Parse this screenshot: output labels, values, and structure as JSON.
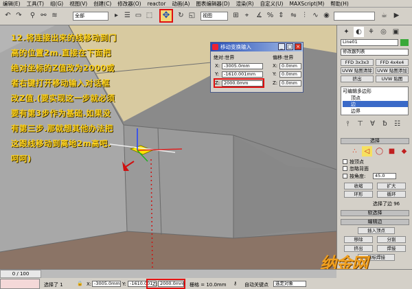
{
  "menu": [
    "编辑(E)",
    "工具(T)",
    "组(G)",
    "视图(V)",
    "创建(C)",
    "修改器(O)",
    "reactor",
    "动画(A)",
    "图表编辑器(D)",
    "渲染(R)",
    "自定义(U)",
    "MAXScript(M)",
    "帮助(H)"
  ],
  "toolbar": {
    "selection_filter": "全部",
    "coord_system": "视图"
  },
  "instruction": "12.将连接出来的线移动到门高的位置2m.直接在下面把绝对坐标的Z值改为2000或者右键打开移动输入对话框改Z值.(要实现这一步就必须要有第3步作为基础.如果没有第三步.那就想其他办法把这跟线移动到离地2m高吧.呵呵)",
  "dialog": {
    "title": "移动变换输入",
    "absolute_label": "绝对:世界",
    "offset_label": "偏移:世界",
    "absolute": {
      "x": "-3005.0mm",
      "y": "-1610.001mm",
      "z": "2000.0mm"
    },
    "offset": {
      "x": "0.0mm",
      "y": "0.0mm",
      "z": "0.0mm"
    },
    "axes": [
      "X:",
      "Y:",
      "Z:"
    ]
  },
  "panel": {
    "object_name": "Line01",
    "modifier_list": "修改器列表",
    "buttons": [
      "FFD 3x3x3",
      "FFD 4x4x4",
      "UVW 贴图清除",
      "UVW 贴图添加",
      "挤出",
      "UVW 贴图"
    ],
    "stack": [
      "可编辑多边形",
      "顶点",
      "边",
      "边界"
    ],
    "selection_rollout": "选择",
    "by_vertex": "按顶点",
    "ignore_backfacing": "忽略背面",
    "by_angle": "按角度:",
    "angle_value": "45.0",
    "shrink": "收缩",
    "grow": "扩大",
    "ring": "环形",
    "loop": "循环",
    "selected_info": "选择了边 96",
    "soft_selection": "软选择",
    "edit_edges": "编辑边",
    "insert_vertex": "插入顶点",
    "remove": "移除",
    "split": "分割",
    "extrude": "挤出",
    "weld": "焊接",
    "target_weld": "目标焊接"
  },
  "status": {
    "time": "0 / 100",
    "selected": "选择了 1",
    "x": "-3005.0mm",
    "y": "-1610.001",
    "z": "2000.0mm",
    "grid": "栅格 = 10.0mm",
    "autokey": "自动关键点",
    "select_obj": "选定对象"
  },
  "watermark": "纳金网",
  "colors": {
    "instruction": "#ffd31c",
    "highlight": "#e01010"
  }
}
